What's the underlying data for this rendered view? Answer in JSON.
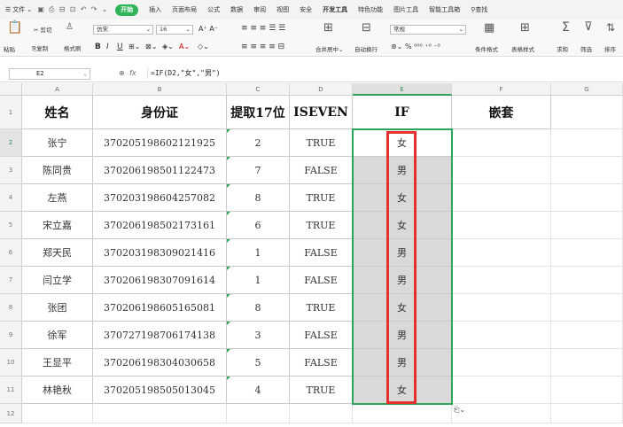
{
  "menubar": {
    "file_label": "文件",
    "tabs": [
      "开始",
      "插入",
      "页面布局",
      "公式",
      "数据",
      "审阅",
      "视图",
      "安全",
      "开发工具",
      "特色功能",
      "图片工具",
      "智能工具箱"
    ],
    "active_tab": "开始",
    "search_label": "查找"
  },
  "ribbon": {
    "paste_label": "粘贴",
    "cut_label": "剪切",
    "copy_label": "复制",
    "format_painter_label": "格式刷",
    "font_name": "仿宋",
    "font_size": "16",
    "merge_label": "合并居中",
    "wrap_label": "自动换行",
    "number_format": "常规",
    "cond_format_label": "条件格式",
    "table_style_label": "表格样式",
    "sum_label": "求和",
    "filter_label": "筛选",
    "sort_label": "排序"
  },
  "formula_bar": {
    "cell_ref": "E2",
    "formula": "=IF(D2,\"女\",\"男\")"
  },
  "columns": [
    "A",
    "B",
    "C",
    "D",
    "E",
    "F",
    "G"
  ],
  "active_column": "E",
  "row_numbers": [
    "1",
    "2",
    "3",
    "4",
    "5",
    "6",
    "7",
    "8",
    "9",
    "10",
    "11",
    "12"
  ],
  "active_row": "2",
  "headers": [
    "姓名",
    "身份证",
    "提取17位",
    "ISEVEN",
    "IF",
    "嵌套"
  ],
  "rows": [
    {
      "name": "张宁",
      "id": "370205198602121925",
      "digit": "2",
      "iseven": "TRUE",
      "if": "女"
    },
    {
      "name": "陈同贵",
      "id": "370206198501122473",
      "digit": "7",
      "iseven": "FALSE",
      "if": "男"
    },
    {
      "name": "左燕",
      "id": "370203198604257082",
      "digit": "8",
      "iseven": "TRUE",
      "if": "女"
    },
    {
      "name": "宋立嘉",
      "id": "370206198502173161",
      "digit": "6",
      "iseven": "TRUE",
      "if": "女"
    },
    {
      "name": "郑天民",
      "id": "370203198309021416",
      "digit": "1",
      "iseven": "FALSE",
      "if": "男"
    },
    {
      "name": "闫立学",
      "id": "370206198307091614",
      "digit": "1",
      "iseven": "FALSE",
      "if": "男"
    },
    {
      "name": "张团",
      "id": "370206198605165081",
      "digit": "8",
      "iseven": "TRUE",
      "if": "女"
    },
    {
      "name": "徐军",
      "id": "370727198706174138",
      "digit": "3",
      "iseven": "FALSE",
      "if": "男"
    },
    {
      "name": "王显平",
      "id": "370206198304030658",
      "digit": "5",
      "iseven": "FALSE",
      "if": "男"
    },
    {
      "name": "林艳秋",
      "id": "370205198505013045",
      "digit": "4",
      "iseven": "TRUE",
      "if": "女"
    }
  ],
  "colors": {
    "accent_green": "#2fa55a",
    "highlight_red": "#e63030",
    "selection_gray": "#d9d9d9"
  }
}
